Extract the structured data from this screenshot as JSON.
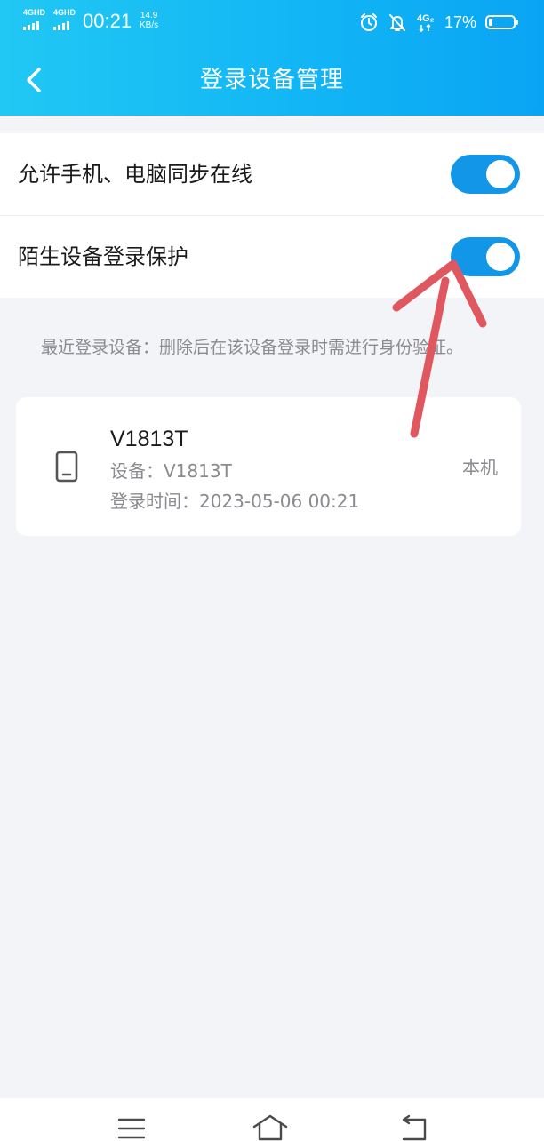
{
  "status_bar": {
    "sim1_network": "4GHD",
    "sim2_network": "4GHD",
    "time": "00:21",
    "speed_value": "14.9",
    "speed_unit": "KB/s",
    "mobile_data_label": "4G₂",
    "battery_percent": "17%",
    "battery_level": 0.17,
    "icons": [
      "signal-icon",
      "alarm-icon",
      "bell-off-icon",
      "mobile-data-icon",
      "battery-icon"
    ]
  },
  "header": {
    "title": "登录设备管理",
    "back_icon": "chevron-left-icon",
    "gradient": [
      "#21c8f4",
      "#0aa4f4"
    ]
  },
  "settings": [
    {
      "label": "允许手机、电脑同步在线",
      "enabled": true
    },
    {
      "label": "陌生设备登录保护",
      "enabled": true
    }
  ],
  "recent_devices": {
    "hint": "最近登录设备：删除后在该设备登录时需进行身份验证。",
    "devices": [
      {
        "name": "V1813T",
        "device_line": "设备：V1813T",
        "login_time_line": "登录时间：2023-05-06 00:21",
        "tag": "本机",
        "icon": "phone-icon"
      }
    ]
  },
  "nav_bar": {
    "icons": [
      "menu-icon",
      "home-icon",
      "back-icon"
    ]
  },
  "colors": {
    "accent": "#1296e8",
    "page_background": "#f3f4f8",
    "annotation_arrow": "#e0585f"
  }
}
